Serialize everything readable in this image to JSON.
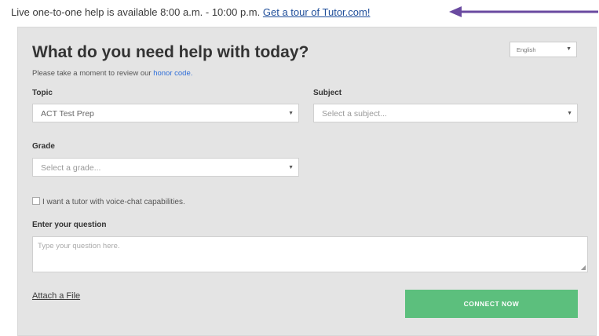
{
  "header": {
    "availability_text": "Live one-to-one help is available 8:00 a.m. - 10:00 p.m.",
    "tour_link": "Get a tour of Tutor.com!",
    "arrow_color": "#6a4aa0"
  },
  "panel": {
    "title": "What do you need help with today?",
    "honor_prefix": "Please take a moment to review our",
    "honor_link": "honor code.",
    "language": {
      "selected": "English"
    }
  },
  "form": {
    "topic": {
      "label": "Topic",
      "selected": "ACT Test Prep"
    },
    "subject": {
      "label": "Subject",
      "placeholder": "Select a subject..."
    },
    "grade": {
      "label": "Grade",
      "placeholder": "Select a grade..."
    },
    "voice_checkbox": {
      "label": "I want a tutor with voice-chat capabilities.",
      "checked": false
    },
    "question": {
      "label": "Enter your question",
      "placeholder": "Type your question here."
    },
    "attach_label": "Attach a File",
    "connect_label": "CONNECT NOW"
  },
  "colors": {
    "panel_bg": "#e4e4e4",
    "connect_button": "#5cbf7d",
    "link_blue": "#2f6ed8"
  },
  "icons": {
    "dropdown": "chevron-down-icon",
    "arrow": "arrow-left-icon"
  }
}
